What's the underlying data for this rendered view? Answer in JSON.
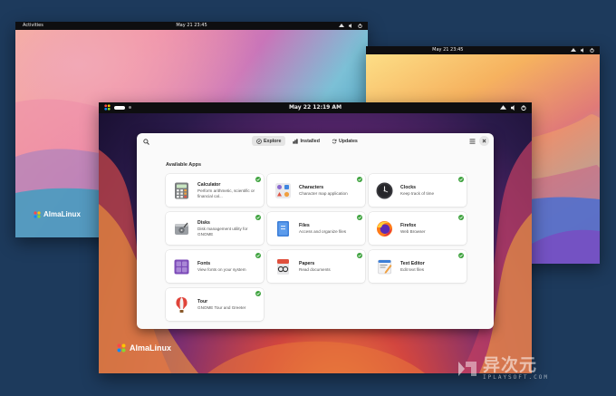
{
  "screen_left": {
    "topbar": {
      "activities": "Activities",
      "clock": "May 21  23:45"
    },
    "logo_text": "AlmaLinux"
  },
  "screen_right": {
    "topbar": {
      "clock": "May 21  23:45"
    }
  },
  "screen_front": {
    "topbar": {
      "clock": "May 22  12:19 AM"
    },
    "logo_text": "AlmaLinux"
  },
  "software": {
    "tabs": [
      {
        "label": "Explore",
        "icon": "compass-icon",
        "active": true
      },
      {
        "label": "Installed",
        "icon": "installed-icon",
        "active": false
      },
      {
        "label": "Updates",
        "icon": "refresh-icon",
        "active": false
      }
    ],
    "section_title": "Available Apps",
    "apps": [
      {
        "name": "Calculator",
        "desc": "Perform arithmetic, scientific or financial cal...",
        "icon": "calculator-icon"
      },
      {
        "name": "Characters",
        "desc": "Character map application",
        "icon": "characters-icon"
      },
      {
        "name": "Clocks",
        "desc": "Keep track of time",
        "icon": "clocks-icon"
      },
      {
        "name": "Disks",
        "desc": "Disk management utility for GNOME",
        "icon": "disks-icon"
      },
      {
        "name": "Files",
        "desc": "Access and organize files",
        "icon": "files-icon"
      },
      {
        "name": "Firefox",
        "desc": "Web Browser",
        "icon": "firefox-icon"
      },
      {
        "name": "Fonts",
        "desc": "View fonts on your system",
        "icon": "fonts-icon"
      },
      {
        "name": "Papers",
        "desc": "Read documents",
        "icon": "papers-icon"
      },
      {
        "name": "Text Editor",
        "desc": "Edit text files",
        "icon": "text-editor-icon"
      },
      {
        "name": "Tour",
        "desc": "GNOME Tour and Greeter",
        "icon": "tour-icon"
      }
    ]
  },
  "watermark": {
    "main": "异次元",
    "sub": "IPLAYSOFT.COM"
  },
  "colors": {
    "accent_green": "#3fa33f",
    "panel_bg": "#0e0e10",
    "window_bg": "#fafafa"
  }
}
